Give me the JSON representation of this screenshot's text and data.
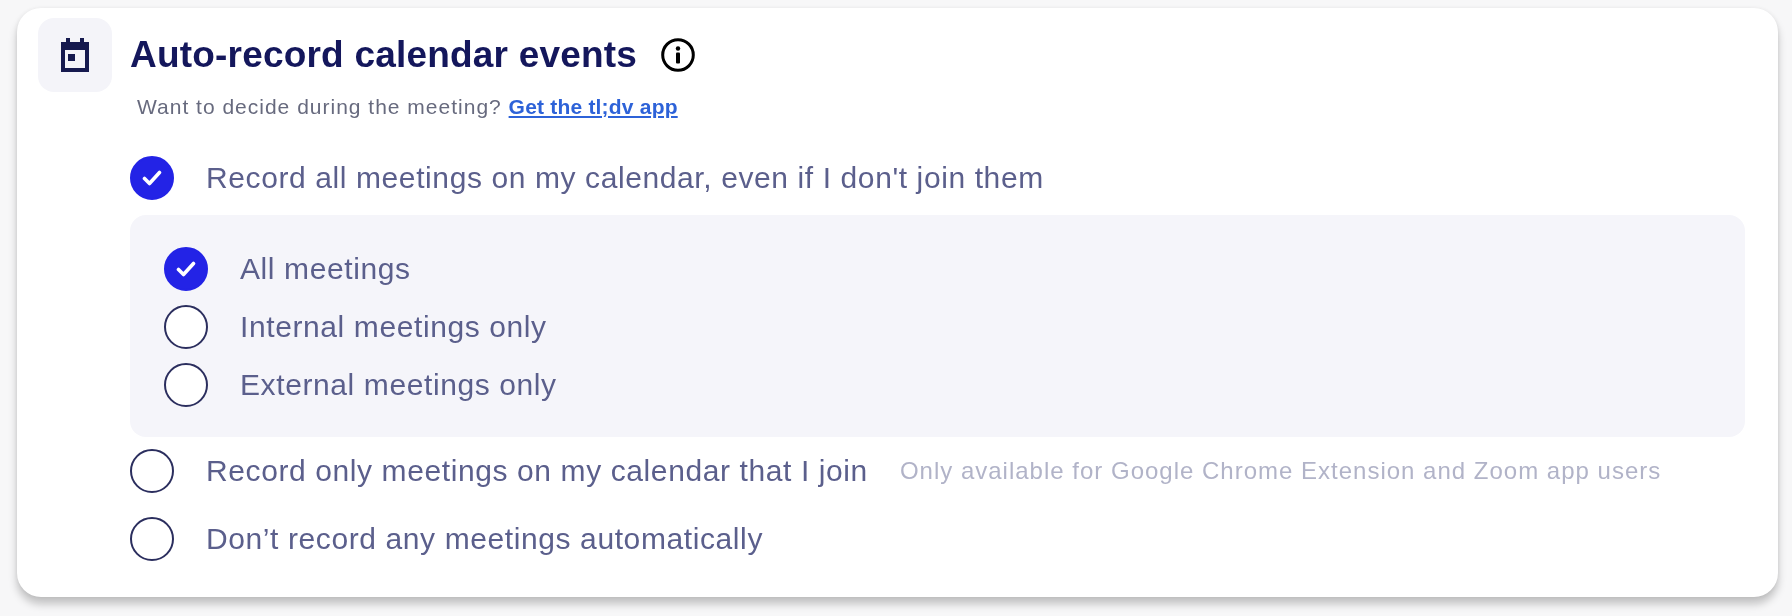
{
  "header": {
    "title": "Auto-record calendar events",
    "subtitle": "Want to decide during the meeting?",
    "link": "Get the tl;dv app"
  },
  "options": [
    {
      "label": "Record all meetings on my calendar, even if I don't join them",
      "selected": true,
      "suboptions": [
        {
          "label": "All meetings",
          "selected": true
        },
        {
          "label": "Internal meetings only",
          "selected": false
        },
        {
          "label": "External meetings only",
          "selected": false
        }
      ]
    },
    {
      "label": "Record only meetings on my calendar that I join",
      "selected": false,
      "note": "Only available for Google Chrome Extension and Zoom app users"
    },
    {
      "label": "Don’t record any meetings automatically",
      "selected": false
    }
  ]
}
